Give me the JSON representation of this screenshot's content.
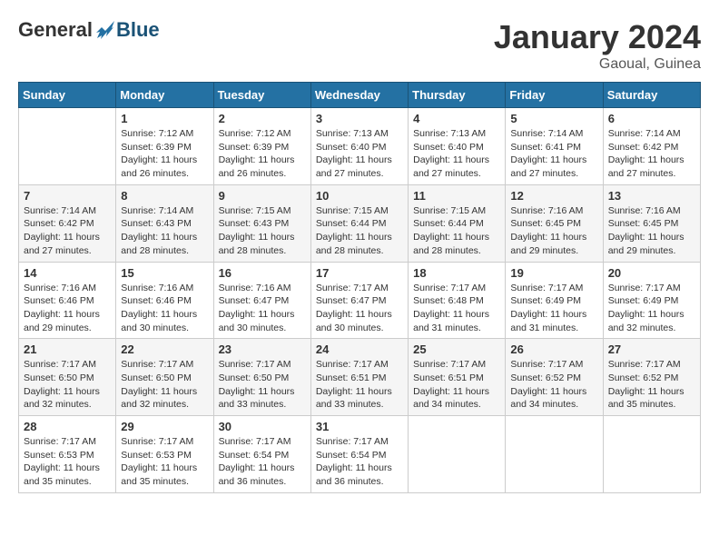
{
  "logo": {
    "general": "General",
    "blue": "Blue"
  },
  "title": "January 2024",
  "location": "Gaoual, Guinea",
  "days_of_week": [
    "Sunday",
    "Monday",
    "Tuesday",
    "Wednesday",
    "Thursday",
    "Friday",
    "Saturday"
  ],
  "weeks": [
    [
      {
        "day": "",
        "info": ""
      },
      {
        "day": "1",
        "info": "Sunrise: 7:12 AM\nSunset: 6:39 PM\nDaylight: 11 hours\nand 26 minutes."
      },
      {
        "day": "2",
        "info": "Sunrise: 7:12 AM\nSunset: 6:39 PM\nDaylight: 11 hours\nand 26 minutes."
      },
      {
        "day": "3",
        "info": "Sunrise: 7:13 AM\nSunset: 6:40 PM\nDaylight: 11 hours\nand 27 minutes."
      },
      {
        "day": "4",
        "info": "Sunrise: 7:13 AM\nSunset: 6:40 PM\nDaylight: 11 hours\nand 27 minutes."
      },
      {
        "day": "5",
        "info": "Sunrise: 7:14 AM\nSunset: 6:41 PM\nDaylight: 11 hours\nand 27 minutes."
      },
      {
        "day": "6",
        "info": "Sunrise: 7:14 AM\nSunset: 6:42 PM\nDaylight: 11 hours\nand 27 minutes."
      }
    ],
    [
      {
        "day": "7",
        "info": "Sunrise: 7:14 AM\nSunset: 6:42 PM\nDaylight: 11 hours\nand 27 minutes."
      },
      {
        "day": "8",
        "info": "Sunrise: 7:14 AM\nSunset: 6:43 PM\nDaylight: 11 hours\nand 28 minutes."
      },
      {
        "day": "9",
        "info": "Sunrise: 7:15 AM\nSunset: 6:43 PM\nDaylight: 11 hours\nand 28 minutes."
      },
      {
        "day": "10",
        "info": "Sunrise: 7:15 AM\nSunset: 6:44 PM\nDaylight: 11 hours\nand 28 minutes."
      },
      {
        "day": "11",
        "info": "Sunrise: 7:15 AM\nSunset: 6:44 PM\nDaylight: 11 hours\nand 28 minutes."
      },
      {
        "day": "12",
        "info": "Sunrise: 7:16 AM\nSunset: 6:45 PM\nDaylight: 11 hours\nand 29 minutes."
      },
      {
        "day": "13",
        "info": "Sunrise: 7:16 AM\nSunset: 6:45 PM\nDaylight: 11 hours\nand 29 minutes."
      }
    ],
    [
      {
        "day": "14",
        "info": "Sunrise: 7:16 AM\nSunset: 6:46 PM\nDaylight: 11 hours\nand 29 minutes."
      },
      {
        "day": "15",
        "info": "Sunrise: 7:16 AM\nSunset: 6:46 PM\nDaylight: 11 hours\nand 30 minutes."
      },
      {
        "day": "16",
        "info": "Sunrise: 7:16 AM\nSunset: 6:47 PM\nDaylight: 11 hours\nand 30 minutes."
      },
      {
        "day": "17",
        "info": "Sunrise: 7:17 AM\nSunset: 6:47 PM\nDaylight: 11 hours\nand 30 minutes."
      },
      {
        "day": "18",
        "info": "Sunrise: 7:17 AM\nSunset: 6:48 PM\nDaylight: 11 hours\nand 31 minutes."
      },
      {
        "day": "19",
        "info": "Sunrise: 7:17 AM\nSunset: 6:49 PM\nDaylight: 11 hours\nand 31 minutes."
      },
      {
        "day": "20",
        "info": "Sunrise: 7:17 AM\nSunset: 6:49 PM\nDaylight: 11 hours\nand 32 minutes."
      }
    ],
    [
      {
        "day": "21",
        "info": "Sunrise: 7:17 AM\nSunset: 6:50 PM\nDaylight: 11 hours\nand 32 minutes."
      },
      {
        "day": "22",
        "info": "Sunrise: 7:17 AM\nSunset: 6:50 PM\nDaylight: 11 hours\nand 32 minutes."
      },
      {
        "day": "23",
        "info": "Sunrise: 7:17 AM\nSunset: 6:50 PM\nDaylight: 11 hours\nand 33 minutes."
      },
      {
        "day": "24",
        "info": "Sunrise: 7:17 AM\nSunset: 6:51 PM\nDaylight: 11 hours\nand 33 minutes."
      },
      {
        "day": "25",
        "info": "Sunrise: 7:17 AM\nSunset: 6:51 PM\nDaylight: 11 hours\nand 34 minutes."
      },
      {
        "day": "26",
        "info": "Sunrise: 7:17 AM\nSunset: 6:52 PM\nDaylight: 11 hours\nand 34 minutes."
      },
      {
        "day": "27",
        "info": "Sunrise: 7:17 AM\nSunset: 6:52 PM\nDaylight: 11 hours\nand 35 minutes."
      }
    ],
    [
      {
        "day": "28",
        "info": "Sunrise: 7:17 AM\nSunset: 6:53 PM\nDaylight: 11 hours\nand 35 minutes."
      },
      {
        "day": "29",
        "info": "Sunrise: 7:17 AM\nSunset: 6:53 PM\nDaylight: 11 hours\nand 35 minutes."
      },
      {
        "day": "30",
        "info": "Sunrise: 7:17 AM\nSunset: 6:54 PM\nDaylight: 11 hours\nand 36 minutes."
      },
      {
        "day": "31",
        "info": "Sunrise: 7:17 AM\nSunset: 6:54 PM\nDaylight: 11 hours\nand 36 minutes."
      },
      {
        "day": "",
        "info": ""
      },
      {
        "day": "",
        "info": ""
      },
      {
        "day": "",
        "info": ""
      }
    ]
  ]
}
